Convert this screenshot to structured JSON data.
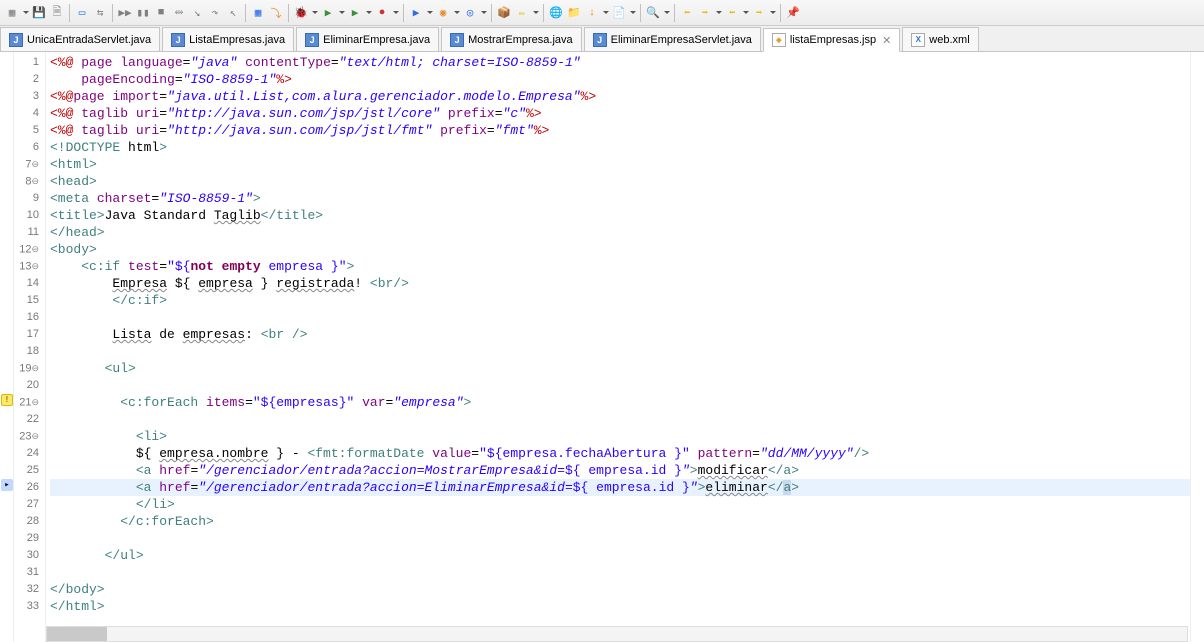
{
  "tabs": [
    {
      "label": "UnicaEntradaServlet.java",
      "type": "java",
      "active": false
    },
    {
      "label": "ListaEmpresas.java",
      "type": "java",
      "active": false
    },
    {
      "label": "EliminarEmpresa.java",
      "type": "java",
      "active": false
    },
    {
      "label": "MostrarEmpresa.java",
      "type": "java",
      "active": false
    },
    {
      "label": "EliminarEmpresaServlet.java",
      "type": "java",
      "active": false
    },
    {
      "label": "listaEmpresas.jsp",
      "type": "jsp",
      "active": true
    },
    {
      "label": "web.xml",
      "type": "xml",
      "active": false
    }
  ],
  "gutter": {
    "fold_lines": [
      7,
      8,
      12,
      13,
      19,
      21,
      23
    ],
    "warning_line": 21,
    "current_line": 26
  },
  "code": {
    "lines": [
      {
        "n": 1,
        "seg": [
          [
            "dirred",
            "<%@ "
          ],
          [
            "attr",
            "page "
          ],
          [
            "attr",
            "language"
          ],
          [
            "txt",
            "="
          ],
          [
            "str",
            "\"java\""
          ],
          [
            "txt",
            " "
          ],
          [
            "attr",
            "contentType"
          ],
          [
            "txt",
            "="
          ],
          [
            "str",
            "\"text/html; charset=ISO-8859-1\""
          ]
        ]
      },
      {
        "n": 2,
        "seg": [
          [
            "txt",
            "    "
          ],
          [
            "attr",
            "pageEncoding"
          ],
          [
            "txt",
            "="
          ],
          [
            "str",
            "\"ISO-8859-1\""
          ],
          [
            "dirred",
            "%>"
          ]
        ]
      },
      {
        "n": 3,
        "seg": [
          [
            "dirred",
            "<%@"
          ],
          [
            "attr",
            "page "
          ],
          [
            "attr",
            "import"
          ],
          [
            "txt",
            "="
          ],
          [
            "str",
            "\"java.util.List,com.alura.gerenciador.modelo.Empresa\""
          ],
          [
            "dirred",
            "%>"
          ]
        ]
      },
      {
        "n": 4,
        "seg": [
          [
            "dirred",
            "<%@ "
          ],
          [
            "attr",
            "taglib "
          ],
          [
            "attr",
            "uri"
          ],
          [
            "txt",
            "="
          ],
          [
            "str",
            "\"http://java.sun.com/jsp/jstl/core\""
          ],
          [
            "txt",
            " "
          ],
          [
            "attr",
            "prefix"
          ],
          [
            "txt",
            "="
          ],
          [
            "str",
            "\"c\""
          ],
          [
            "dirred",
            "%>"
          ]
        ]
      },
      {
        "n": 5,
        "seg": [
          [
            "dirred",
            "<%@ "
          ],
          [
            "attr",
            "taglib "
          ],
          [
            "attr",
            "uri"
          ],
          [
            "txt",
            "="
          ],
          [
            "str",
            "\"http://java.sun.com/jsp/jstl/fmt\""
          ],
          [
            "txt",
            " "
          ],
          [
            "attr",
            "prefix"
          ],
          [
            "txt",
            "="
          ],
          [
            "str",
            "\"fmt\""
          ],
          [
            "dirred",
            "%>"
          ]
        ]
      },
      {
        "n": 6,
        "seg": [
          [
            "tag",
            "<!DOCTYPE "
          ],
          [
            "txt",
            "html"
          ],
          [
            "tag",
            ">"
          ]
        ]
      },
      {
        "n": 7,
        "fold": true,
        "seg": [
          [
            "tag",
            "<html>"
          ]
        ]
      },
      {
        "n": 8,
        "fold": true,
        "seg": [
          [
            "tag",
            "<head>"
          ]
        ]
      },
      {
        "n": 9,
        "seg": [
          [
            "tag",
            "<meta "
          ],
          [
            "attr",
            "charset"
          ],
          [
            "txt",
            "="
          ],
          [
            "str",
            "\"ISO-8859-1\""
          ],
          [
            "tag",
            ">"
          ]
        ]
      },
      {
        "n": 10,
        "seg": [
          [
            "tag",
            "<title>"
          ],
          [
            "txt",
            "Java Standard "
          ],
          [
            "ul",
            "Taglib"
          ],
          [
            "tag",
            "</title>"
          ]
        ]
      },
      {
        "n": 11,
        "seg": [
          [
            "tag",
            "</head>"
          ]
        ]
      },
      {
        "n": 12,
        "fold": true,
        "seg": [
          [
            "tag",
            "<body>"
          ]
        ]
      },
      {
        "n": 13,
        "fold": true,
        "seg": [
          [
            "txt",
            "    "
          ],
          [
            "tag",
            "<c:if "
          ],
          [
            "attr",
            "test"
          ],
          [
            "txt",
            "="
          ],
          [
            "strn",
            "\"${"
          ],
          [
            "kw",
            "not empty"
          ],
          [
            "strn",
            " empresa }\""
          ],
          [
            "tag",
            ">"
          ]
        ]
      },
      {
        "n": 14,
        "seg": [
          [
            "txt",
            "        "
          ],
          [
            "ul",
            "Empresa"
          ],
          [
            "txt",
            " ${ "
          ],
          [
            "ul",
            "empresa"
          ],
          [
            "txt",
            " } "
          ],
          [
            "ul",
            "registrada"
          ],
          [
            "txt",
            "! "
          ],
          [
            "tag",
            "<br/>"
          ]
        ]
      },
      {
        "n": 15,
        "seg": [
          [
            "txt",
            "        "
          ],
          [
            "tag",
            "</c:if>"
          ]
        ]
      },
      {
        "n": 16,
        "seg": [
          [
            "txt",
            ""
          ]
        ]
      },
      {
        "n": 17,
        "seg": [
          [
            "txt",
            "        "
          ],
          [
            "ul",
            "Lista"
          ],
          [
            "txt",
            " de "
          ],
          [
            "ul",
            "empresas"
          ],
          [
            "txt",
            ": "
          ],
          [
            "tag",
            "<br />"
          ]
        ]
      },
      {
        "n": 18,
        "seg": [
          [
            "txt",
            ""
          ]
        ]
      },
      {
        "n": 19,
        "fold": true,
        "seg": [
          [
            "txt",
            "       "
          ],
          [
            "tag",
            "<ul>"
          ]
        ]
      },
      {
        "n": 20,
        "seg": [
          [
            "txt",
            ""
          ]
        ]
      },
      {
        "n": 21,
        "fold": true,
        "warn": true,
        "seg": [
          [
            "txt",
            "         "
          ],
          [
            "tag",
            "<c:forEach "
          ],
          [
            "attr",
            "items"
          ],
          [
            "txt",
            "="
          ],
          [
            "strn",
            "\"${empresas}\""
          ],
          [
            "txt",
            " "
          ],
          [
            "attr",
            "var"
          ],
          [
            "txt",
            "="
          ],
          [
            "str",
            "\"empresa\""
          ],
          [
            "tag",
            ">"
          ]
        ]
      },
      {
        "n": 22,
        "seg": [
          [
            "txt",
            ""
          ]
        ]
      },
      {
        "n": 23,
        "fold": true,
        "seg": [
          [
            "txt",
            "           "
          ],
          [
            "tag",
            "<li>"
          ]
        ]
      },
      {
        "n": 24,
        "seg": [
          [
            "txt",
            "           ${ "
          ],
          [
            "ul",
            "empresa.nombre"
          ],
          [
            "txt",
            " } - "
          ],
          [
            "tag",
            "<fmt:formatDate "
          ],
          [
            "attr",
            "value"
          ],
          [
            "txt",
            "="
          ],
          [
            "strn",
            "\"${empresa.fechaAbertura }\""
          ],
          [
            "txt",
            " "
          ],
          [
            "attr",
            "pattern"
          ],
          [
            "txt",
            "="
          ],
          [
            "str",
            "\"dd/MM/yyyy\""
          ],
          [
            "tag",
            "/>"
          ]
        ]
      },
      {
        "n": 25,
        "seg": [
          [
            "txt",
            "           "
          ],
          [
            "tag",
            "<a "
          ],
          [
            "attr",
            "href"
          ],
          [
            "txt",
            "="
          ],
          [
            "str",
            "\"/gerenciador/entrada?accion=MostrarEmpresa&id"
          ],
          [
            "strn",
            "="
          ],
          [
            "strn",
            "${ empresa.id }"
          ],
          [
            "str",
            "\""
          ],
          [
            "tag",
            ">"
          ],
          [
            "ul",
            "modificar"
          ],
          [
            "tag",
            "</a>"
          ]
        ]
      },
      {
        "n": 26,
        "hl": true,
        "seg": [
          [
            "txt",
            "           "
          ],
          [
            "tag",
            "<a "
          ],
          [
            "attr",
            "href"
          ],
          [
            "txt",
            "="
          ],
          [
            "str",
            "\"/gerenciador/entrada?accion=EliminarEmpresa&id"
          ],
          [
            "strn",
            "="
          ],
          [
            "strn",
            "${ empresa.id }"
          ],
          [
            "str",
            "\""
          ],
          [
            "tag",
            ">"
          ],
          [
            "ul",
            "eliminar"
          ],
          [
            "tag",
            "</"
          ],
          [
            "tagsel",
            "a"
          ],
          [
            "tag",
            ">"
          ]
        ]
      },
      {
        "n": 27,
        "seg": [
          [
            "txt",
            "           "
          ],
          [
            "tag",
            "</li>"
          ]
        ]
      },
      {
        "n": 28,
        "seg": [
          [
            "txt",
            "         "
          ],
          [
            "tag",
            "</c:forEach>"
          ]
        ]
      },
      {
        "n": 29,
        "seg": [
          [
            "txt",
            ""
          ]
        ]
      },
      {
        "n": 30,
        "seg": [
          [
            "txt",
            "       "
          ],
          [
            "tag",
            "</ul>"
          ]
        ]
      },
      {
        "n": 31,
        "seg": [
          [
            "txt",
            ""
          ]
        ]
      },
      {
        "n": 32,
        "seg": [
          [
            "tag",
            "</body>"
          ]
        ]
      },
      {
        "n": 33,
        "seg": [
          [
            "tag",
            "</html>"
          ]
        ]
      }
    ]
  }
}
